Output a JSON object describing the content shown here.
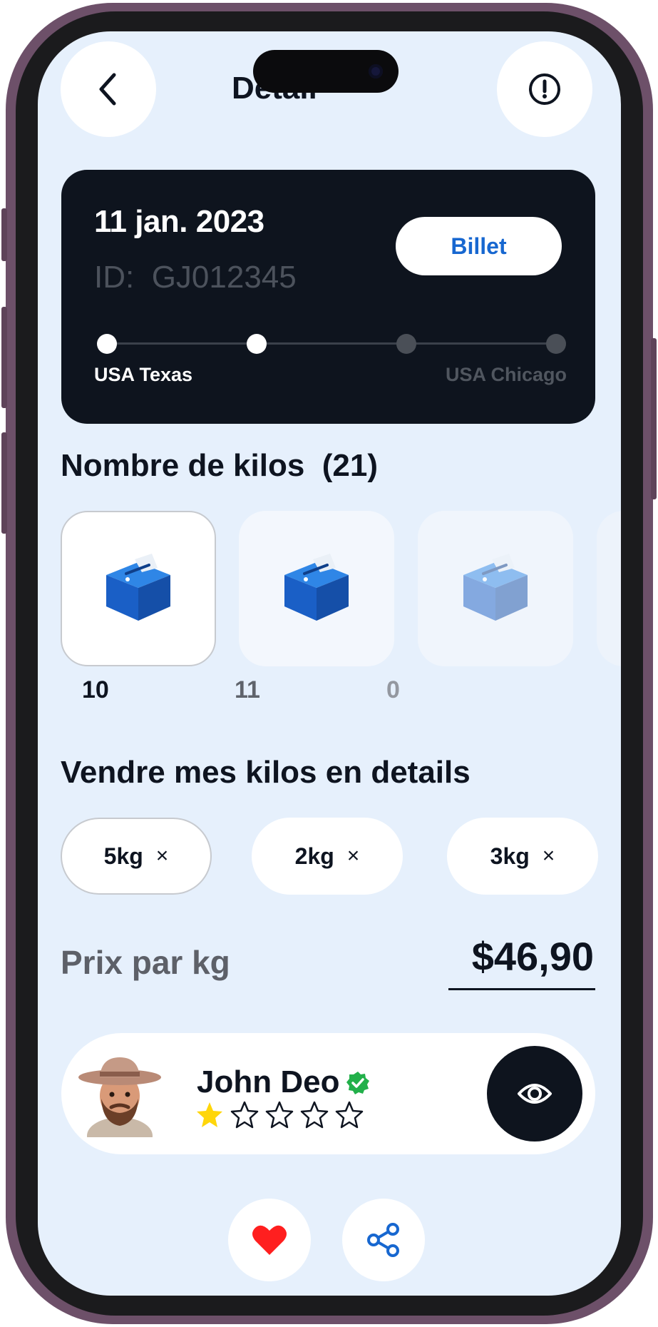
{
  "header": {
    "title": "Detail",
    "back_icon": "chevron-left-icon",
    "info_icon": "exclamation-circle-icon"
  },
  "ticket": {
    "date": "11 jan. 2023",
    "id_label": "ID:",
    "id_value": "GJ012345",
    "billet_label": "Billet",
    "route": {
      "from": "USA Texas",
      "to": "USA Chicago",
      "stops_total": 4,
      "stops_reached": 2
    }
  },
  "kilos": {
    "title": "Nombre de kilos",
    "count": "(21)",
    "options": [
      {
        "value": "10",
        "selected": true
      },
      {
        "value": "11",
        "selected": false
      },
      {
        "value": "0",
        "selected": false
      }
    ]
  },
  "details": {
    "title": "Vendre mes kilos en details",
    "chips": [
      {
        "label": "5kg",
        "remove": "×"
      },
      {
        "label": "2kg",
        "remove": "×"
      },
      {
        "label": "3kg",
        "remove": "×"
      }
    ]
  },
  "price": {
    "label": "Prix par kg",
    "value": "$46,90"
  },
  "seller": {
    "name": "John Deo",
    "verified": true,
    "rating": 1,
    "rating_max": 5
  },
  "actions": {
    "like_icon": "heart-icon",
    "share_icon": "share-icon",
    "view_icon": "eye-icon"
  },
  "colors": {
    "accent": "#1767d0",
    "dark": "#0e141e",
    "background": "#e6f0fc",
    "like": "#ff1f1f",
    "verified": "#22b04a",
    "star": "#ffd60a"
  }
}
